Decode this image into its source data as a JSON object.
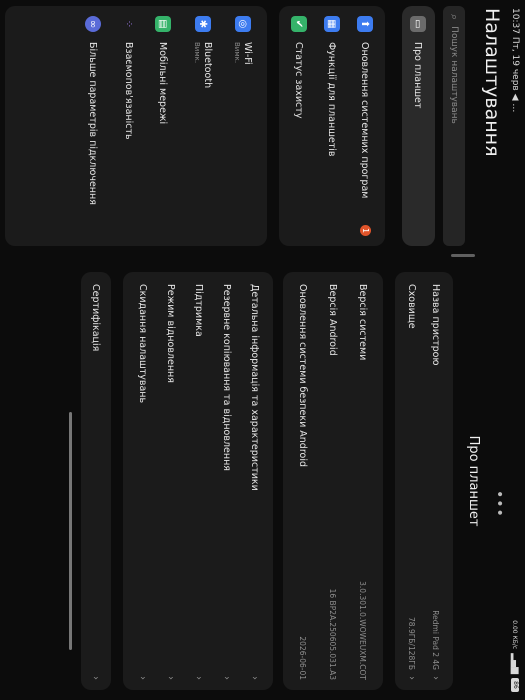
{
  "status_bar": {
    "time": "10:37",
    "date": "Пт, 19 черв",
    "nav_indicator": "◀ …",
    "speed": "0.00 КБ/с",
    "signal": "▂▄▆",
    "battery": "86"
  },
  "sidebar": {
    "title": "Налаштування",
    "search_placeholder": "Пошук налаштувань",
    "items": [
      {
        "label": "Про планшет",
        "icon": "tablet-icon",
        "color": "#6b6b6b"
      },
      {
        "label": "Оновлення системних програм",
        "icon": "arrow-up-icon",
        "color": "#3d7cf0",
        "badge": "1"
      },
      {
        "label": "Функції для планшетів",
        "icon": "grid-icon",
        "color": "#3d7cf0"
      },
      {
        "label": "Статус захисту",
        "icon": "shield-icon",
        "color": "#35b36a"
      },
      {
        "label": "Wi-Fi",
        "sub": "Вимк.",
        "icon": "wifi-icon",
        "color": "#3d7cf0"
      },
      {
        "label": "Bluetooth",
        "sub": "Вимк.",
        "icon": "bluetooth-icon",
        "color": "#3d7cf0"
      },
      {
        "label": "Мобільні мережі",
        "icon": "mobile-network-icon",
        "color": "#35b36a"
      },
      {
        "label": "Взаємопов'язаність",
        "icon": "connectivity-icon",
        "color": "#7a4fd8"
      },
      {
        "label": "Більше параметрів підключення",
        "icon": "link-icon",
        "color": "#5a6bd8"
      }
    ]
  },
  "main": {
    "title": "Про планшет",
    "card1": [
      {
        "label": "Назва пристрою",
        "value": "Redmi Pad 2 4G"
      },
      {
        "label": "Сховище",
        "value": "78.9ГБ/128ГБ"
      }
    ],
    "card2": [
      {
        "label": "Версія системи",
        "value": "3.0.301.0.WOWEUXM.COT"
      },
      {
        "label": "Версія Android",
        "value": "16 BP2A.250605.031.A3"
      },
      {
        "label": "Оновлення системи безпеки Android",
        "value": "2026-06-01"
      }
    ],
    "card3": [
      {
        "label": "Детальна інформація та характеристики"
      },
      {
        "label": "Резервне копіювання та відновлення"
      },
      {
        "label": "Підтримка"
      },
      {
        "label": "Режим відновлення"
      },
      {
        "label": "Скидання налаштувань"
      }
    ],
    "card4": [
      {
        "label": "Сертифікація"
      }
    ]
  }
}
